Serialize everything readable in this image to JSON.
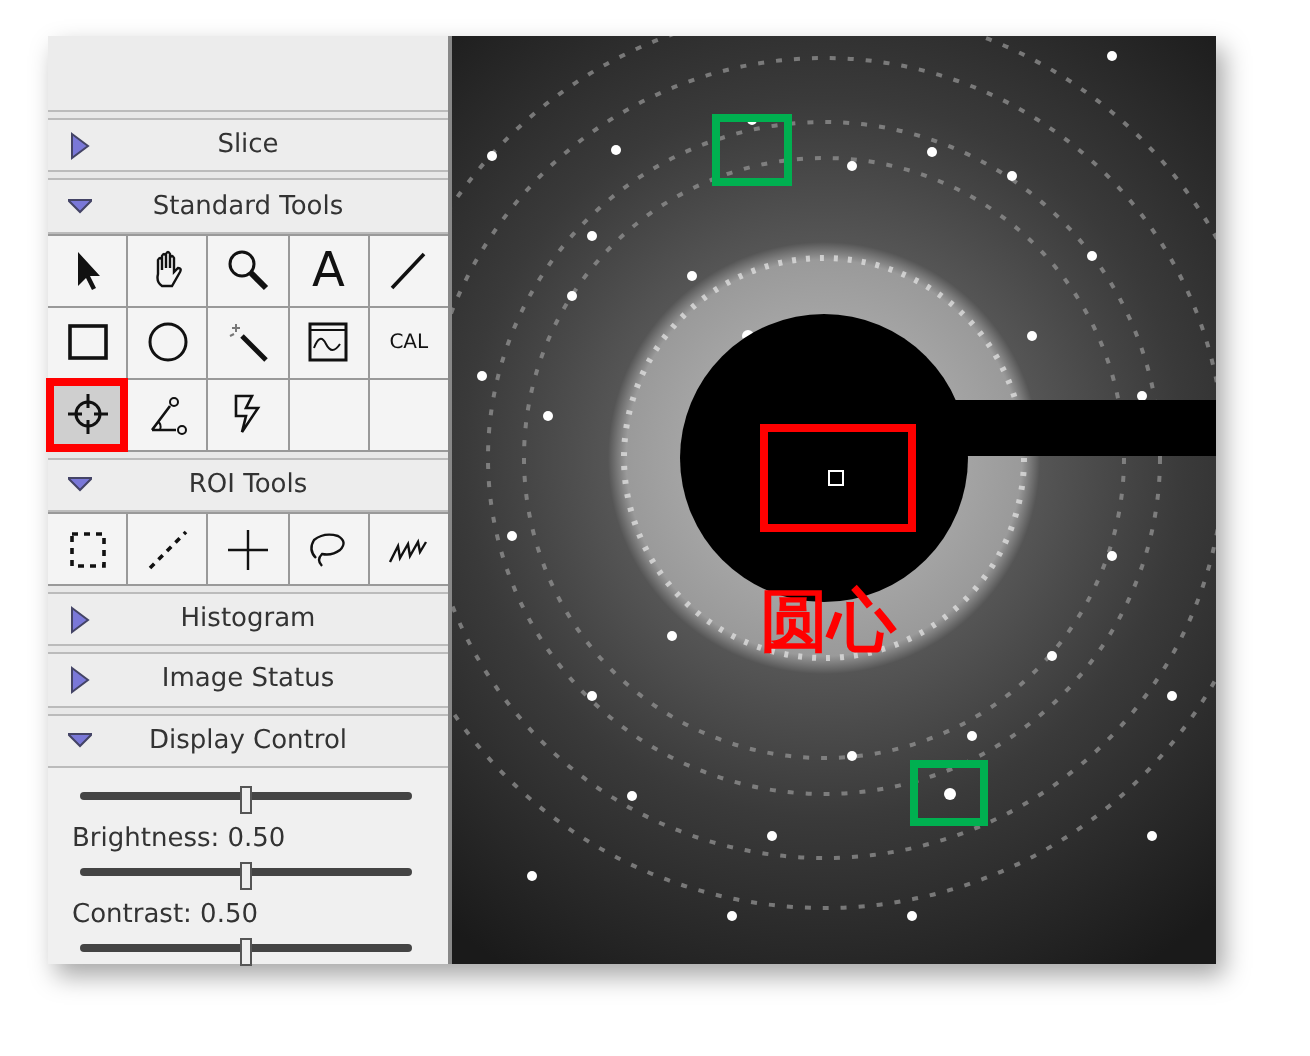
{
  "panel": {
    "sections": [
      {
        "title": "Slice",
        "expanded": false
      },
      {
        "title": "Standard Tools",
        "expanded": true,
        "tools": [
          {
            "kind": "pointer",
            "selected": false,
            "marked": false
          },
          {
            "kind": "hand",
            "selected": false,
            "marked": false
          },
          {
            "kind": "magnifier",
            "selected": false,
            "marked": false
          },
          {
            "kind": "text",
            "label": "A",
            "selected": false,
            "marked": false
          },
          {
            "kind": "line",
            "selected": false,
            "marked": false
          },
          {
            "kind": "rectangle",
            "selected": false,
            "marked": false
          },
          {
            "kind": "oval",
            "selected": false,
            "marked": false
          },
          {
            "kind": "wand",
            "selected": false,
            "marked": false
          },
          {
            "kind": "profile",
            "selected": false,
            "marked": false
          },
          {
            "kind": "calibrate",
            "label": "CAL",
            "selected": false,
            "marked": false
          },
          {
            "kind": "crosshair",
            "selected": true,
            "marked": true
          },
          {
            "kind": "angle",
            "selected": false,
            "marked": false
          },
          {
            "kind": "lightning",
            "selected": false,
            "marked": false
          },
          {
            "kind": "empty",
            "selected": false,
            "marked": false
          },
          {
            "kind": "empty",
            "selected": false,
            "marked": false
          }
        ]
      },
      {
        "title": "ROI Tools",
        "expanded": true,
        "tools": [
          {
            "kind": "dashed-rectangle",
            "selected": false,
            "marked": false
          },
          {
            "kind": "dashed-line",
            "selected": false,
            "marked": false
          },
          {
            "kind": "point",
            "selected": false,
            "marked": false
          },
          {
            "kind": "lasso",
            "selected": false,
            "marked": false
          },
          {
            "kind": "squiggle",
            "selected": false,
            "marked": false
          }
        ]
      },
      {
        "title": "Histogram",
        "expanded": false
      },
      {
        "title": "Image Status",
        "expanded": false
      },
      {
        "title": "Display Control",
        "expanded": true,
        "controls": [
          {
            "kind": "slider",
            "level": 0.5
          },
          {
            "kind": "label",
            "text": "Brightness: 0.50"
          },
          {
            "kind": "slider",
            "level": 0.5
          },
          {
            "kind": "label",
            "text": "Contrast: 0.50"
          },
          {
            "kind": "slider",
            "level": 0.5
          }
        ]
      }
    ]
  },
  "image": {
    "annotations": [
      {
        "kind": "box",
        "color": "#00b050"
      },
      {
        "kind": "box",
        "color": "#00b050"
      },
      {
        "kind": "box",
        "color": "#ff0000"
      },
      {
        "kind": "center-mark",
        "color": "#ffffff"
      },
      {
        "kind": "label",
        "color": "#ff0000",
        "text": "圆心"
      }
    ]
  }
}
